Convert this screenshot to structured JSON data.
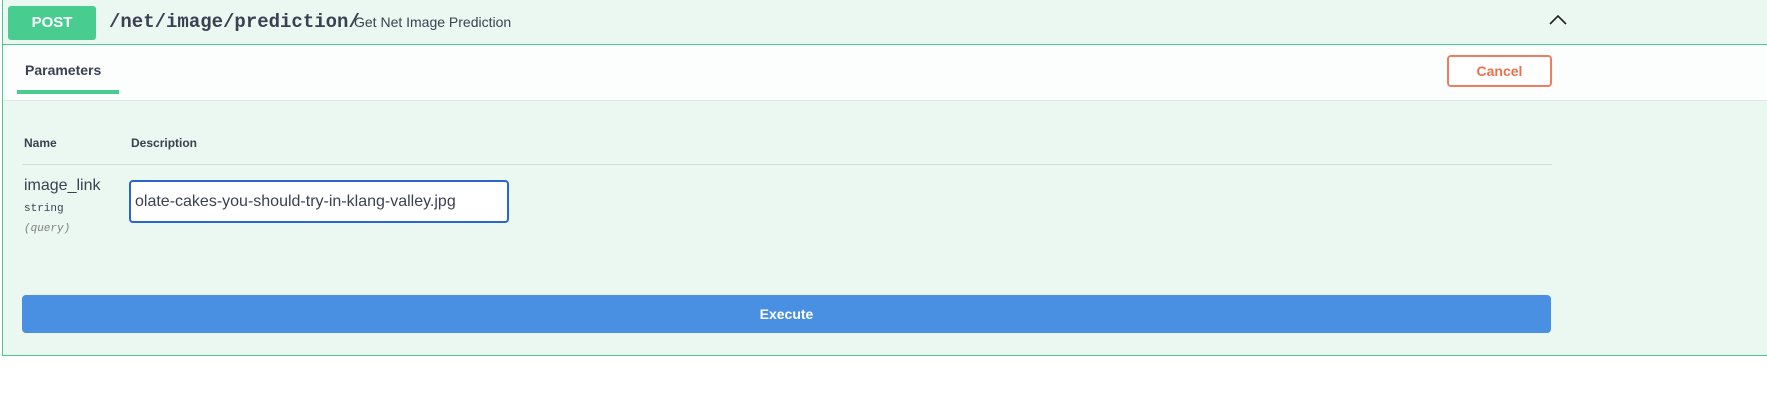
{
  "operation": {
    "method": "POST",
    "path": "/net/image/prediction/",
    "summary": "Get Net Image Prediction"
  },
  "tabs": {
    "parameters": "Parameters"
  },
  "buttons": {
    "cancel": "Cancel",
    "execute": "Execute"
  },
  "table": {
    "headers": [
      "Name",
      "Description"
    ]
  },
  "parameters": [
    {
      "name": "image_link",
      "type": "string",
      "in": "(query)",
      "value": "olate-cakes-you-should-try-in-klang-valley.jpg"
    }
  ]
}
